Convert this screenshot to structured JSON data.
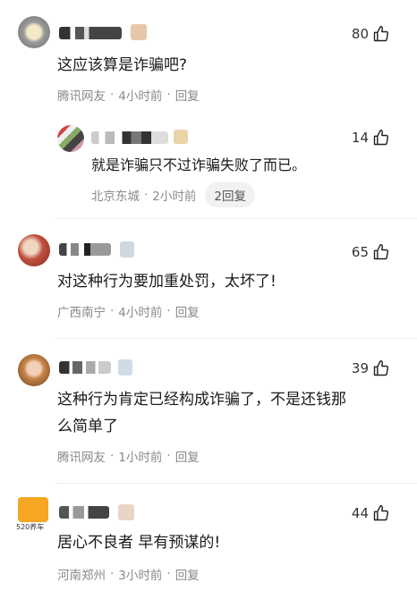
{
  "comments": [
    {
      "likes": "80",
      "text": "这应该算是诈骗吧?",
      "location": "腾讯网友",
      "time": "4小时前",
      "reply_label": "回复"
    },
    {
      "likes": "14",
      "text": "就是诈骗只不过诈骗失败了而已。",
      "location": "北京东城",
      "time": "2小时前",
      "reply_label": "2回复"
    },
    {
      "likes": "65",
      "text": "对这种行为要加重处罚，太坏了!",
      "location": "广西南宁",
      "time": "4小时前",
      "reply_label": "回复"
    },
    {
      "likes": "39",
      "text_line1": "这种行为肯定已经构成诈骗了，不是还钱那",
      "text_line2": "么简单了",
      "location": "腾讯网友",
      "time": "1小时前",
      "reply_label": "回复"
    },
    {
      "likes": "44",
      "avatar_caption": "520养车",
      "text": "居心不良者 早有预谋的!",
      "location": "河南郑州",
      "time": "3小时前",
      "reply_label": "回复"
    }
  ],
  "colors": {
    "meta_gray": "#8a8a8a",
    "reply_pill_bg": "#f1f1f1",
    "text": "#1a1a1a"
  },
  "icons": {
    "like": "thumbs-up-outline-icon"
  }
}
